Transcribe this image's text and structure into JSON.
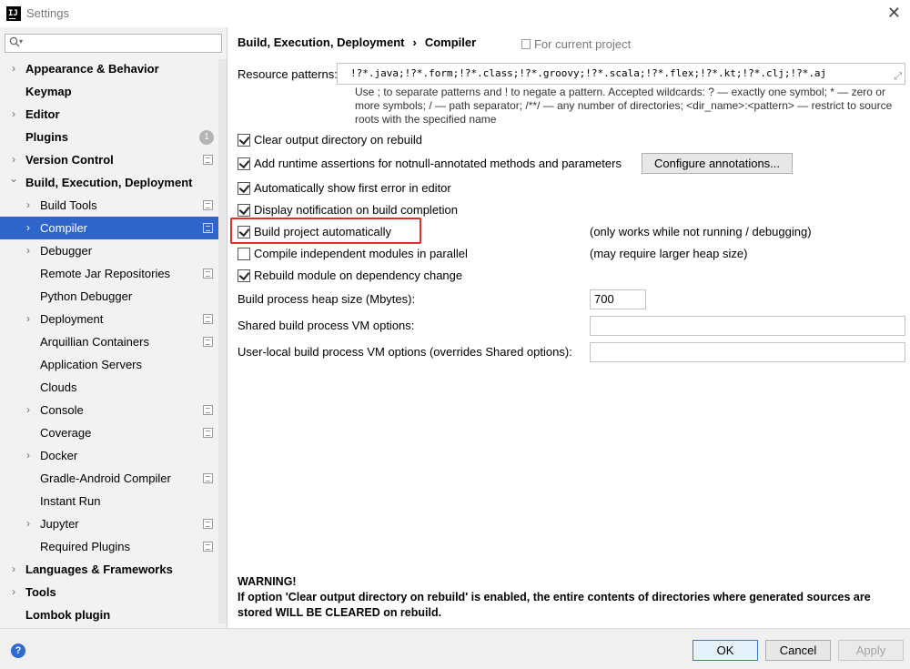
{
  "window": {
    "title": "Settings",
    "app_icon_text": "IJ"
  },
  "sidebar": {
    "search_placeholder": "",
    "items": [
      {
        "label": "Appearance & Behavior",
        "level": 0,
        "expandable": true,
        "bold": true
      },
      {
        "label": "Keymap",
        "level": 0,
        "expandable": false,
        "bold": true
      },
      {
        "label": "Editor",
        "level": 0,
        "expandable": true,
        "bold": true
      },
      {
        "label": "Plugins",
        "level": 0,
        "expandable": false,
        "bold": true,
        "badge": "1"
      },
      {
        "label": "Version Control",
        "level": 0,
        "expandable": true,
        "bold": true,
        "page_icon": true
      },
      {
        "label": "Build, Execution, Deployment",
        "level": 0,
        "expandable": true,
        "expanded": true,
        "bold": true
      },
      {
        "label": "Build Tools",
        "level": 1,
        "expandable": true,
        "page_icon": true
      },
      {
        "label": "Compiler",
        "level": 1,
        "expandable": true,
        "page_icon": true,
        "selected": true
      },
      {
        "label": "Debugger",
        "level": 1,
        "expandable": true
      },
      {
        "label": "Remote Jar Repositories",
        "level": 1,
        "expandable": false,
        "page_icon": true
      },
      {
        "label": "Python Debugger",
        "level": 1,
        "expandable": false
      },
      {
        "label": "Deployment",
        "level": 1,
        "expandable": true,
        "page_icon": true
      },
      {
        "label": "Arquillian Containers",
        "level": 1,
        "expandable": false,
        "page_icon": true
      },
      {
        "label": "Application Servers",
        "level": 1,
        "expandable": false
      },
      {
        "label": "Clouds",
        "level": 1,
        "expandable": false
      },
      {
        "label": "Console",
        "level": 1,
        "expandable": true,
        "page_icon": true
      },
      {
        "label": "Coverage",
        "level": 1,
        "expandable": false,
        "page_icon": true
      },
      {
        "label": "Docker",
        "level": 1,
        "expandable": true
      },
      {
        "label": "Gradle-Android Compiler",
        "level": 1,
        "expandable": false,
        "page_icon": true
      },
      {
        "label": "Instant Run",
        "level": 1,
        "expandable": false
      },
      {
        "label": "Jupyter",
        "level": 1,
        "expandable": true,
        "page_icon": true
      },
      {
        "label": "Required Plugins",
        "level": 1,
        "expandable": false,
        "page_icon": true
      },
      {
        "label": "Languages & Frameworks",
        "level": 0,
        "expandable": true,
        "bold": true
      },
      {
        "label": "Tools",
        "level": 0,
        "expandable": true,
        "bold": true
      },
      {
        "label": "Lombok plugin",
        "level": 0,
        "expandable": false,
        "bold": true
      }
    ]
  },
  "main": {
    "breadcrumb": {
      "parent": "Build, Execution, Deployment",
      "separator": "›",
      "current": "Compiler"
    },
    "scope_label": "For current project",
    "resource_patterns": {
      "label": "Resource patterns:",
      "value": "!?*.java;!?*.form;!?*.class;!?*.groovy;!?*.scala;!?*.flex;!?*.kt;!?*.clj;!?*.aj",
      "help": "Use ; to separate patterns and ! to negate a pattern. Accepted wildcards: ? — exactly one symbol; * — zero or more symbols; / — path separator; /**/ — any number of directories; <dir_name>:<pattern> — restrict to source roots with the specified name"
    },
    "options": [
      {
        "label": "Clear output directory on rebuild",
        "checked": true
      },
      {
        "label": "Add runtime assertions for notnull-annotated methods and parameters",
        "checked": true,
        "button": "Configure annotations..."
      },
      {
        "label": "Automatically show first error in editor",
        "checked": true
      },
      {
        "label": "Display notification on build completion",
        "checked": true
      },
      {
        "label": "Build project automatically",
        "checked": true,
        "note": "(only works while not running / debugging)"
      },
      {
        "label": "Compile independent modules in parallel",
        "checked": false,
        "note": "(may require larger heap size)"
      },
      {
        "label": "Rebuild module on dependency change",
        "checked": true
      }
    ],
    "heap_size": {
      "label": "Build process heap size (Mbytes):",
      "value": "700"
    },
    "shared_vm": {
      "label": "Shared build process VM options:",
      "value": ""
    },
    "user_vm": {
      "label": "User-local build process VM options (overrides Shared options):",
      "value": ""
    },
    "warning": {
      "title": "WARNING!",
      "text": "If option 'Clear output directory on rebuild' is enabled, the entire contents of directories where generated sources are stored WILL BE CLEARED on rebuild."
    },
    "highlight_color": "#e0302a"
  },
  "footer": {
    "help_icon": "?",
    "ok_label": "OK",
    "cancel_label": "Cancel",
    "apply_label": "Apply"
  },
  "colors": {
    "selection": "#2f65ca",
    "sidebar_bg": "#f2f2f2",
    "help_blue": "#2d6bd1"
  }
}
